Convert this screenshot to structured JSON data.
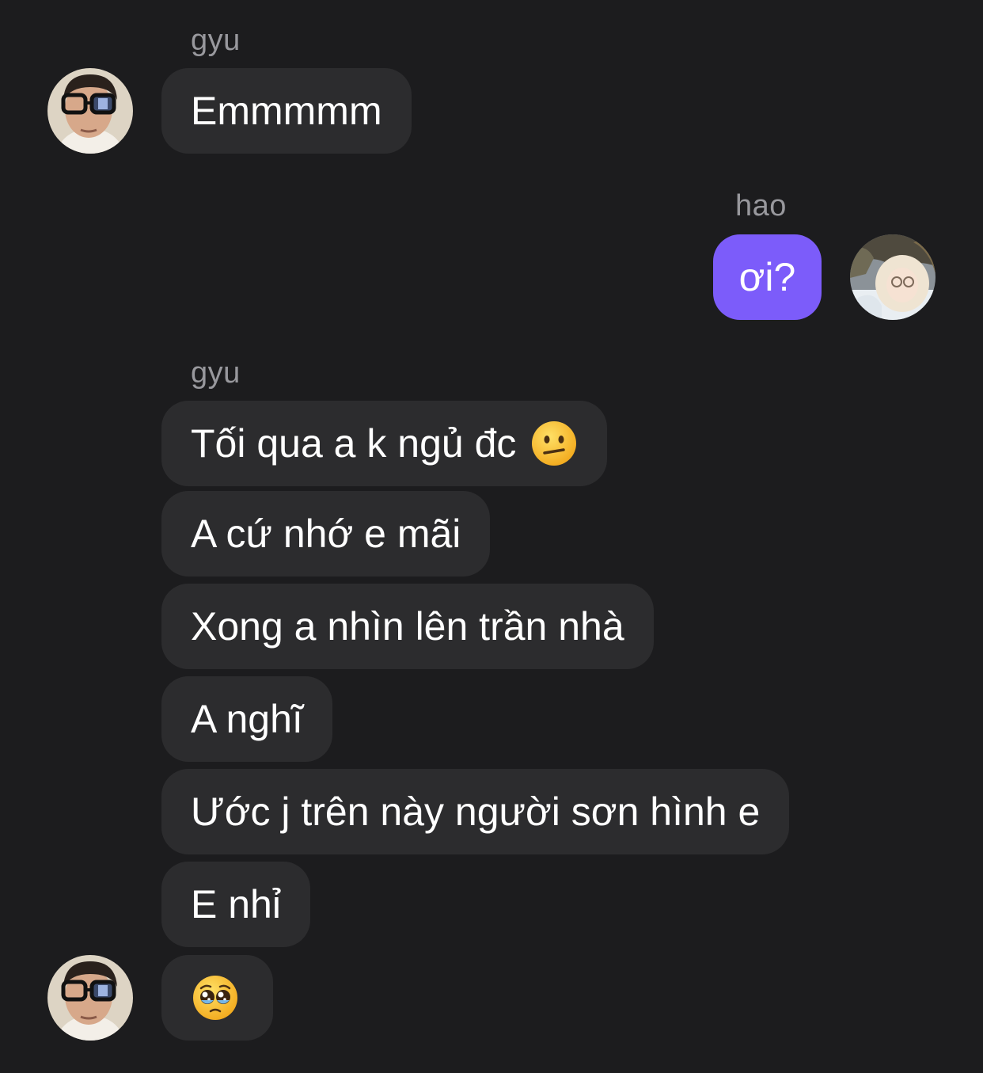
{
  "senders": {
    "other": "gyu",
    "self": "hao"
  },
  "messages": [
    {
      "from": "gyu",
      "text": "Emmmmm"
    },
    {
      "from": "hao",
      "text": "ơi?"
    },
    {
      "from": "gyu",
      "text": "Tối qua a k ngủ đc",
      "emoji": "neutral-face-emoji"
    },
    {
      "from": "gyu",
      "text": "A cứ nhớ e mãi"
    },
    {
      "from": "gyu",
      "text": "Xong a nhìn lên trần nhà"
    },
    {
      "from": "gyu",
      "text": "A nghĩ"
    },
    {
      "from": "gyu",
      "text": "Ước j trên này người sơn hình e"
    },
    {
      "from": "gyu",
      "text": "E nhỉ"
    },
    {
      "from": "gyu",
      "text": "",
      "emoji": "pleading-face-emoji"
    }
  ],
  "colors": {
    "background": "#1c1c1e",
    "incoming_bubble": "#2c2c2e",
    "outgoing_bubble": "#7c5cfa",
    "sender_label": "#98989d"
  },
  "icons": {
    "gyu_avatar": "avatar-gyu",
    "hao_avatar": "avatar-hao"
  }
}
